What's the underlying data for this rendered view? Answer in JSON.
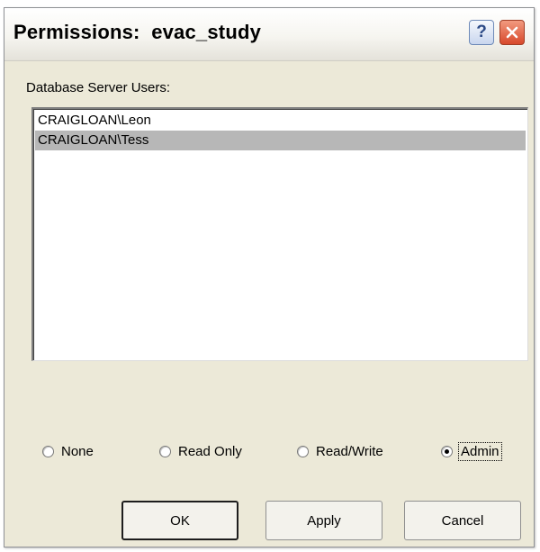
{
  "window": {
    "title": "Permissions:  evac_study",
    "help_glyph": "?",
    "close_icon": "close-icon"
  },
  "users": {
    "label": "Database Server Users:",
    "items": [
      {
        "name": "CRAIGLOAN\\Leon",
        "selected": false
      },
      {
        "name": "CRAIGLOAN\\Tess",
        "selected": true
      }
    ]
  },
  "permissions": {
    "options": [
      {
        "label": "None",
        "checked": false
      },
      {
        "label": "Read Only",
        "checked": false
      },
      {
        "label": "Read/Write",
        "checked": false
      },
      {
        "label": "Admin",
        "checked": true
      }
    ],
    "selected": "Admin"
  },
  "buttons": {
    "ok": "OK",
    "apply": "Apply",
    "cancel": "Cancel"
  },
  "colors": {
    "dialog_bg": "#ece9d8",
    "selection": "#b7b7b7",
    "close_button": "#d8482b"
  }
}
